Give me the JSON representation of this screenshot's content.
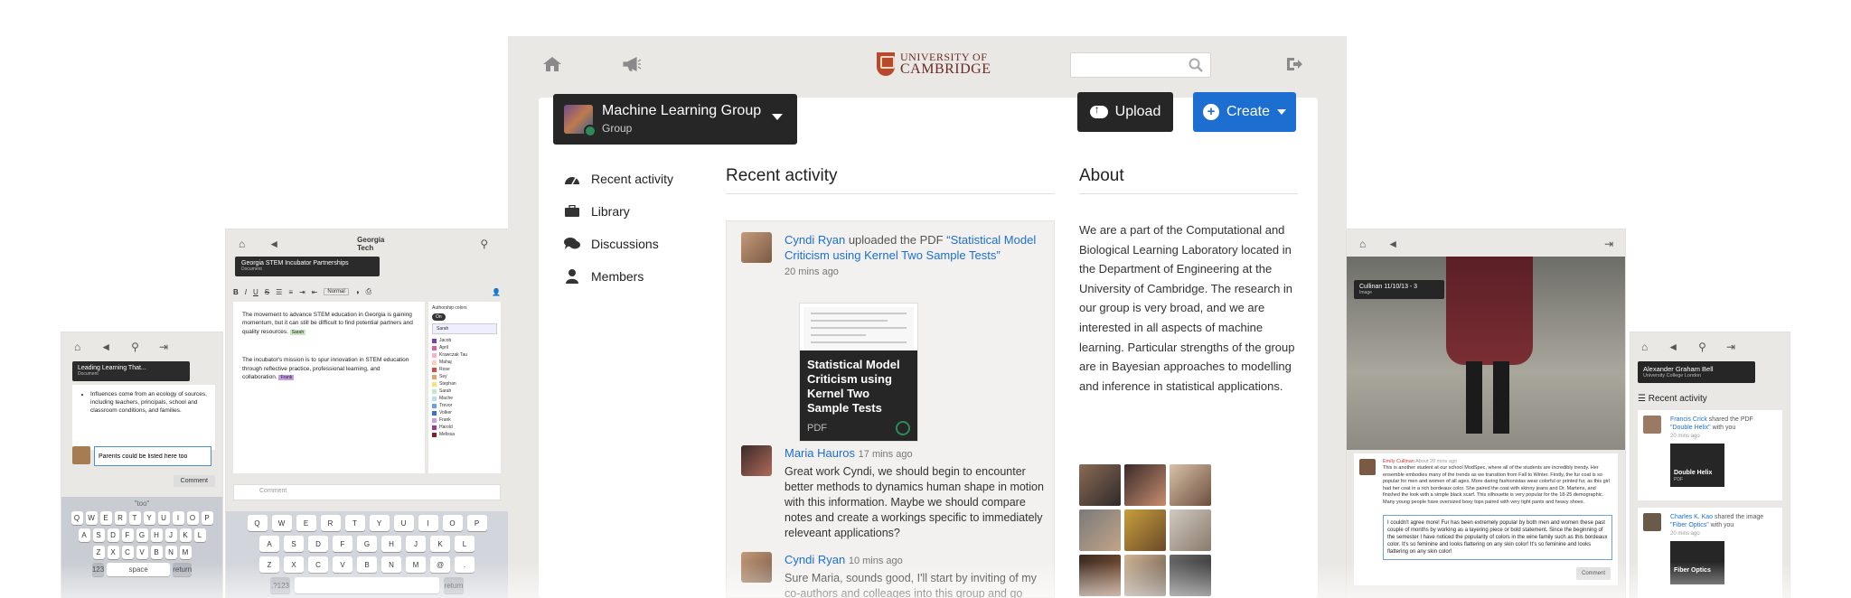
{
  "main": {
    "logo": {
      "line1": "UNIVERSITY OF",
      "line2": "CAMBRIDGE"
    },
    "search": {
      "placeholder": ""
    },
    "group": {
      "name": "Machine Learning Group",
      "type": "Group"
    },
    "upload_label": "Upload",
    "create_label": "Create",
    "nav": [
      "Recent activity",
      "Library",
      "Discussions",
      "Members"
    ],
    "recent_activity_title": "Recent activity",
    "about_title": "About",
    "about_text": "We are a part of the Computational and Biological Learning Laboratory located in the Department of Engineering at the University of Cambridge.  The research in our group is very broad, and we are interested in all aspects of machine learning.  Particular strengths of the group are in Bayesian approaches to modelling and inference in statistical applications.",
    "feed": [
      {
        "author": "Cyndi Ryan",
        "action": " uploaded the PDF ",
        "link": "“Statistical Model Criticism using Kernel Two Sample Tests”",
        "time": "20 mins ago"
      },
      {
        "author": "Maria Hauros",
        "time": "17 mins ago",
        "body": "Great work Cyndi, we should begin to encounter better methods to dynamics human shape in motion with this information. Maybe we should compare notes and create a workings specific to immediately releveant applications?"
      },
      {
        "author": "Cyndi Ryan",
        "time": "10 mins ago",
        "body": "Sure Maria, sounds good, I'll start by inviting of my co-authors and colleages into this group and go"
      }
    ],
    "thumb": {
      "title": "Statistical Model Criticism using Kernel Two Sample Tests",
      "kind": "PDF"
    }
  },
  "tablet_left": {
    "logo": "Georgia Tech",
    "doc_title": "Georgia STEM Incubator Partnerships",
    "doc_sub": "Document",
    "style_select": "Normal",
    "para1": "The movement to advance STEM education in Georgia is gaining momentum, but it can still be difficult to find potential partners and quality resources.",
    "para1_tag": "Sarah",
    "para2": "The incubator's mission is to spur innovation in STEM education through reflective practice, professional learning, and collaboration.",
    "para2_tag": "Frank",
    "authorship_label": "Authorship colors",
    "toggle": "On",
    "selected_author": "Sarah",
    "authors": [
      {
        "name": "Jacob",
        "color": "#7b3fb5"
      },
      {
        "name": "April",
        "color": "#e25f9c"
      },
      {
        "name": "Krawczak Tau",
        "color": "#f3b4d2"
      },
      {
        "name": "Mahaj",
        "color": "#ffd0b5"
      },
      {
        "name": "Rose",
        "color": "#d34a4a"
      },
      {
        "name": "Sey",
        "color": "#e2a26a"
      },
      {
        "name": "Stephan",
        "color": "#f6e27a"
      },
      {
        "name": "Sarah",
        "color": "#c7e6c1"
      },
      {
        "name": "Mache",
        "color": "#b7dff2"
      },
      {
        "name": "Trevor",
        "color": "#6aa0e8"
      },
      {
        "name": "Volker",
        "color": "#3c6fd0"
      },
      {
        "name": "Frank",
        "color": "#c79ce8"
      },
      {
        "name": "Harold",
        "color": "#a13b7a"
      },
      {
        "name": "Melissa",
        "color": "#8a1b2b"
      }
    ],
    "comment_placeholder": "Comment",
    "keys_row1": [
      "Q",
      "W",
      "E",
      "R",
      "T",
      "Y",
      "U",
      "I",
      "O",
      "P"
    ],
    "keys_row2": [
      "A",
      "S",
      "D",
      "F",
      "G",
      "H",
      "J",
      "K",
      "L"
    ],
    "keys_row3": [
      "Z",
      "X",
      "C",
      "V",
      "B",
      "N",
      "M",
      "@",
      "."
    ],
    "key_num": ".?123",
    "key_return": "return"
  },
  "phone_left": {
    "doc_title": "Leading Learning That...",
    "doc_sub": "Document",
    "doc_text": "Influences come from an ecology of sources, including teachers, principals, school and classroom conditions, and families.",
    "doc_text_em": "of sources",
    "reply_value": "Parents could be listed here too",
    "comment_btn": "Comment",
    "suggest": "\"too\"",
    "keys_row1": [
      "Q",
      "W",
      "E",
      "R",
      "T",
      "Y",
      "U",
      "I",
      "O",
      "P"
    ],
    "keys_row2": [
      "A",
      "S",
      "D",
      "F",
      "G",
      "H",
      "J",
      "K",
      "L"
    ],
    "keys_row3": [
      "Z",
      "X",
      "C",
      "V",
      "B",
      "N",
      "M"
    ],
    "key_num": "123",
    "key_space": "space",
    "key_return": "return"
  },
  "tablet_right": {
    "title": "Cullinan 11/10/13 - 3",
    "sub": "Image",
    "commenter": "Emily Cullinan",
    "comment_time": "About 20 mins ago",
    "comment1": "This is another student at our school ModSpec, where all of the students are incredibly trendy. Her ensemble embodies many of the trends as we transition from Fall to Winter. Firstly, the fur coat is so popular for men and women of all ages. More daring fashionistas wear colorful or printed fur, as this girl had her coat in a rich bordeaux color. She paired the coat with skinny jeans and Dr. Martens, and finished the look with a simple black scarf. This silhouette is very popular for the 18-25 demographic. Many young people have oversized boxy tops paired with very tight pants and heavy shoes.",
    "comment2": "I couldn't agree more! Fur has been extremely popular by both men and women these past couple of months by working as a layering piece or bold statement. Since the beginning of the semester I have noticed the popularity of colors in the wine family such as this bordeaux color. It's so feminine and looks flattering on any skin color! It's so feminine and looks flattering on any skin color!",
    "btn": "Comment"
  },
  "phone_right": {
    "name": "Alexander Graham Bell",
    "sub": "University College London",
    "recent": "Recent activity",
    "card1_author": "Francis Crick",
    "card1_action": " shared the PDF ",
    "card1_link": "\"Double Helix\"",
    "card1_tail": " with you",
    "card1_time": "20 mins ago",
    "card1_thumb": "Double Helix",
    "card1_kind": "PDF",
    "card2_author": "Charles K. Kao",
    "card2_action": " shared the image ",
    "card2_link": "\"Fiber Optics\"",
    "card2_tail": " with you",
    "card2_time": "20 mins ago",
    "card2_thumb": "Fiber Optics"
  }
}
